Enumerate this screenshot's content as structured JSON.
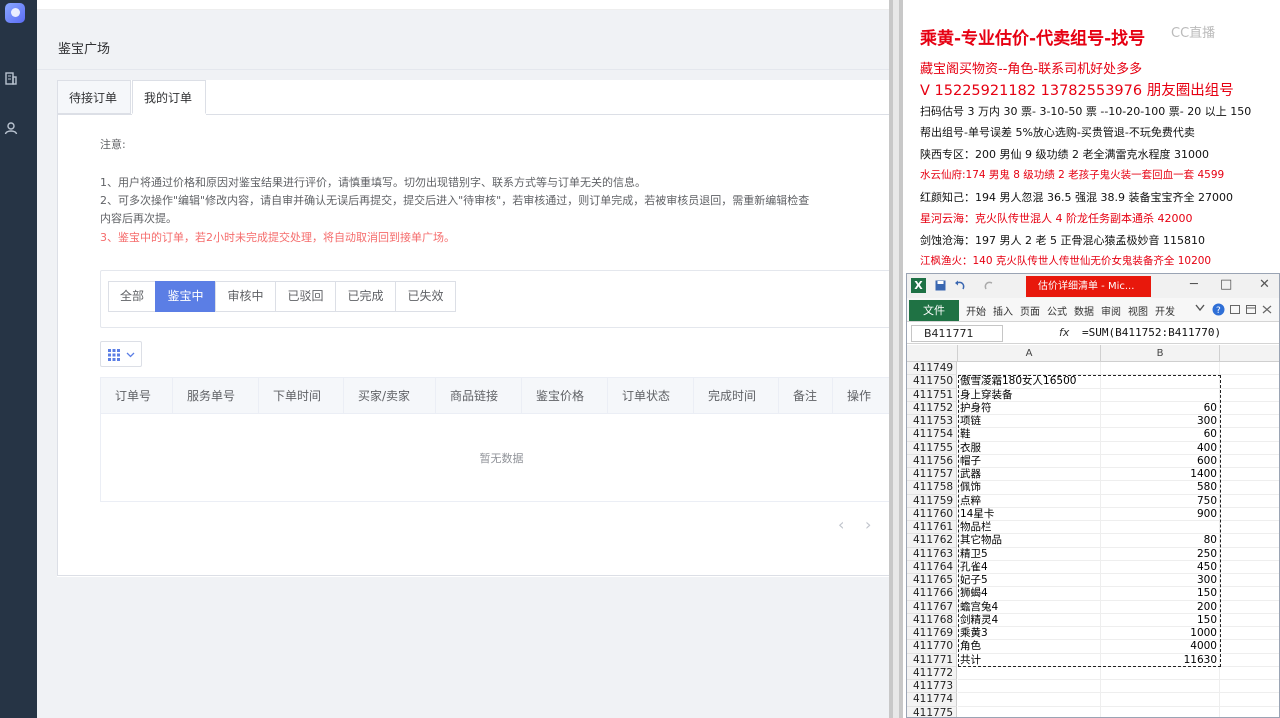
{
  "rail": {
    "icons": [
      "app-logo",
      "building-icon",
      "user-icon"
    ]
  },
  "main": {
    "page_title": "鉴宝广场",
    "tabs": [
      {
        "label": "待接订单"
      },
      {
        "label": "我的订单"
      }
    ],
    "notes": {
      "heading": "注意:",
      "line1": "1、用户将通过价格和原因对鉴宝结果进行评价，请慎重填写。切勿出现错别字、联系方式等与订单无关的信息。",
      "line2a": "2、可多次操作\"编辑\"修改内容，请自审并确认无误后再提交，提交后进入\"待审核\"，若审核通过，则订单完成，若被审核员退回，需重新编辑检查",
      "line2b": "内容后再次提。",
      "line3": "3、鉴宝中的订单，若2小时未完成提交处理，将自动取消回到接单广场。"
    },
    "filters": [
      "全部",
      "鉴宝中",
      "审核中",
      "已驳回",
      "已完成",
      "已失效"
    ],
    "active_filter": "鉴宝中",
    "columns": [
      "订单号",
      "服务单号",
      "下单时间",
      "买家/卖家",
      "商品链接",
      "鉴宝价格",
      "订单状态",
      "完成时间",
      "备注",
      "操作"
    ],
    "empty_text": "暂无数据",
    "pager": {
      "prev": "‹",
      "next": "›"
    }
  },
  "info": {
    "headline": "乘黄-专业估价-代卖组号-找号",
    "watermark": "CC直播",
    "lines": [
      {
        "text": "藏宝阁买物资--角色-联系司机好处多多",
        "color": "red"
      },
      {
        "text": "V 15225921182    13782553976 朋友圈出组号",
        "color": "red"
      },
      {
        "text": "扫码估号 3 万内 30 票- 3-10-50 票  --10-20-100 票- 20 以上 150",
        "color": "black"
      },
      {
        "text": "帮出组号-单号误差 5%放心选购-买贵管退-不玩免费代卖",
        "color": "black"
      },
      {
        "text": "陕西专区：200 男仙 9 级功绩 2 老全满雷克水程度 31000",
        "color": "black"
      },
      {
        "text": "水云仙府:174 男鬼 8 级功绩 2 老孩子鬼火装一套回血一套 4599",
        "color": "red"
      },
      {
        "text": "红颜知己：194 男人忽混 36.5 强混 38.9 装备宝宝齐全 27000",
        "color": "black"
      },
      {
        "text": "星河云海：克火队传世混人 4 阶龙任务副本通杀 42000",
        "color": "red"
      },
      {
        "text": "剑蚀沧海：197 男人 2 老 5 正骨混心猿孟极妙音 115810",
        "color": "black"
      },
      {
        "text": "江枫渔火：140 克火队传世人传世仙无价女鬼装备齐全 10200",
        "color": "red"
      }
    ]
  },
  "excel": {
    "window_title": "估价详细清单 - Mic...",
    "menu": [
      "开始",
      "插入",
      "页面",
      "公式",
      "数据",
      "审阅",
      "视图",
      "开发"
    ],
    "file_label": "文件",
    "name_box": "B411771",
    "fx": "fx",
    "formula": "=SUM(B411752:B411770)",
    "col_a": "A",
    "col_b": "B",
    "rows": [
      {
        "n": "411749",
        "a": "",
        "b": ""
      },
      {
        "n": "411750",
        "a": "傲雪凌霜180女人16500",
        "b": ""
      },
      {
        "n": "411751",
        "a": "身上穿装备",
        "b": ""
      },
      {
        "n": "411752",
        "a": "护身符",
        "b": "60"
      },
      {
        "n": "411753",
        "a": "项链",
        "b": "300"
      },
      {
        "n": "411754",
        "a": "鞋",
        "b": "60"
      },
      {
        "n": "411755",
        "a": "衣服",
        "b": "400"
      },
      {
        "n": "411756",
        "a": "帽子",
        "b": "600"
      },
      {
        "n": "411757",
        "a": "武器",
        "b": "1400"
      },
      {
        "n": "411758",
        "a": "佩饰",
        "b": "580"
      },
      {
        "n": "411759",
        "a": "点粹",
        "b": "750"
      },
      {
        "n": "411760",
        "a": "14星卡",
        "b": "900"
      },
      {
        "n": "411761",
        "a": "物品栏",
        "b": ""
      },
      {
        "n": "411762",
        "a": "其它物品",
        "b": "80"
      },
      {
        "n": "411763",
        "a": "精卫5",
        "b": "250"
      },
      {
        "n": "411764",
        "a": "孔雀4",
        "b": "450"
      },
      {
        "n": "411765",
        "a": "妃子5",
        "b": "300"
      },
      {
        "n": "411766",
        "a": "狮蝎4",
        "b": "150"
      },
      {
        "n": "411767",
        "a": "蟾宫兔4",
        "b": "200"
      },
      {
        "n": "411768",
        "a": "剑精灵4",
        "b": "150"
      },
      {
        "n": "411769",
        "a": "乘黄3",
        "b": "1000"
      },
      {
        "n": "411770",
        "a": "角色",
        "b": "4000"
      },
      {
        "n": "411771",
        "a": "共计",
        "b": "11630"
      },
      {
        "n": "411772",
        "a": "",
        "b": ""
      },
      {
        "n": "411773",
        "a": "",
        "b": ""
      },
      {
        "n": "411774",
        "a": "",
        "b": ""
      },
      {
        "n": "411775",
        "a": "",
        "b": ""
      }
    ]
  }
}
